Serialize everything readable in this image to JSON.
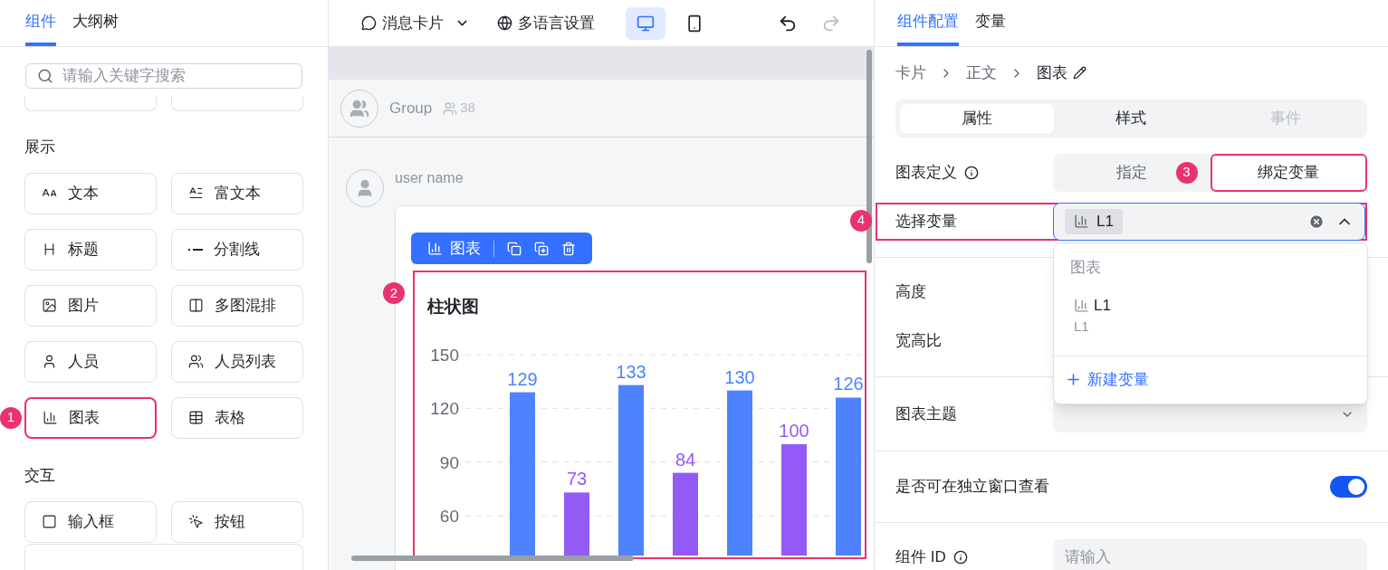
{
  "left_panel": {
    "tabs": [
      {
        "label": "组件",
        "selected": true
      },
      {
        "label": "大纲树",
        "selected": false
      }
    ],
    "search": {
      "placeholder": "请输入关键字搜索"
    },
    "sections": [
      {
        "title": "展示",
        "items": [
          {
            "kind": "text",
            "label": "文本"
          },
          {
            "kind": "rich_text",
            "label": "富文本"
          },
          {
            "kind": "heading",
            "label": "标题"
          },
          {
            "kind": "divider",
            "label": "分割线"
          },
          {
            "kind": "image",
            "label": "图片"
          },
          {
            "kind": "multi_image",
            "label": "多图混排"
          },
          {
            "kind": "person",
            "label": "人员"
          },
          {
            "kind": "person_list",
            "label": "人员列表"
          },
          {
            "kind": "chart",
            "label": "图表",
            "annotation": "1"
          },
          {
            "kind": "table",
            "label": "表格"
          }
        ]
      },
      {
        "title": "交互",
        "items": [
          {
            "kind": "input",
            "label": "输入框"
          },
          {
            "kind": "button",
            "label": "按钮"
          }
        ]
      }
    ]
  },
  "toolbar": {
    "card_type": "消息卡片",
    "language": "多语言设置",
    "devices": [
      {
        "kind": "desktop",
        "selected": true
      },
      {
        "kind": "mobile",
        "selected": false
      }
    ],
    "undo": {
      "disabled": false
    },
    "redo": {
      "disabled": true
    }
  },
  "canvas": {
    "group": {
      "name": "Group",
      "members": "38"
    },
    "message": {
      "sender": "user name",
      "selection_toolbar": {
        "label": "图表"
      },
      "chart": {
        "annotation": "2",
        "chart_data": {
          "type": "bar",
          "title": "柱状图",
          "series": [
            {
              "color": "#4e83fd",
              "values": [
                129,
                null,
                133,
                null,
                130,
                null,
                126
              ]
            },
            {
              "color": "#935af6",
              "values": [
                null,
                73,
                null,
                84,
                null,
                100,
                null
              ]
            }
          ],
          "ylim": [
            37.8,
            150
          ],
          "grid": true,
          "yticks": [
            60,
            90,
            120,
            150
          ],
          "data_labels": true
        }
      }
    }
  },
  "right_panel": {
    "tabs": [
      {
        "label": "组件配置",
        "selected": true
      },
      {
        "label": "变量",
        "selected": false
      }
    ],
    "breadcrumb": [
      "卡片",
      "正文",
      "图表"
    ],
    "segments": [
      {
        "label": "属性",
        "selected": true,
        "disabled": false
      },
      {
        "label": "样式",
        "selected": false,
        "disabled": false
      },
      {
        "label": "事件",
        "selected": false,
        "disabled": true
      }
    ],
    "chart_definition": {
      "label": "图表定义",
      "options": [
        {
          "label": "指定",
          "selected": false
        },
        {
          "label": "绑定变量",
          "selected": true,
          "annotation": "3"
        }
      ]
    },
    "select_variable": {
      "label": "选择变量",
      "tag": "L1",
      "expanded": true,
      "annotation": "4",
      "dropdown": {
        "group": "图表",
        "options": [
          {
            "label": "L1",
            "description": "L1"
          }
        ],
        "action": "新建变量"
      }
    },
    "height": {
      "label": "高度"
    },
    "aspect_ratio": {
      "label": "宽高比"
    },
    "theme": {
      "label": "图表主题"
    },
    "standalone_window": {
      "label": "是否可在独立窗口查看",
      "on": true
    },
    "component_id": {
      "label": "组件 ID",
      "placeholder": "请输入"
    }
  }
}
